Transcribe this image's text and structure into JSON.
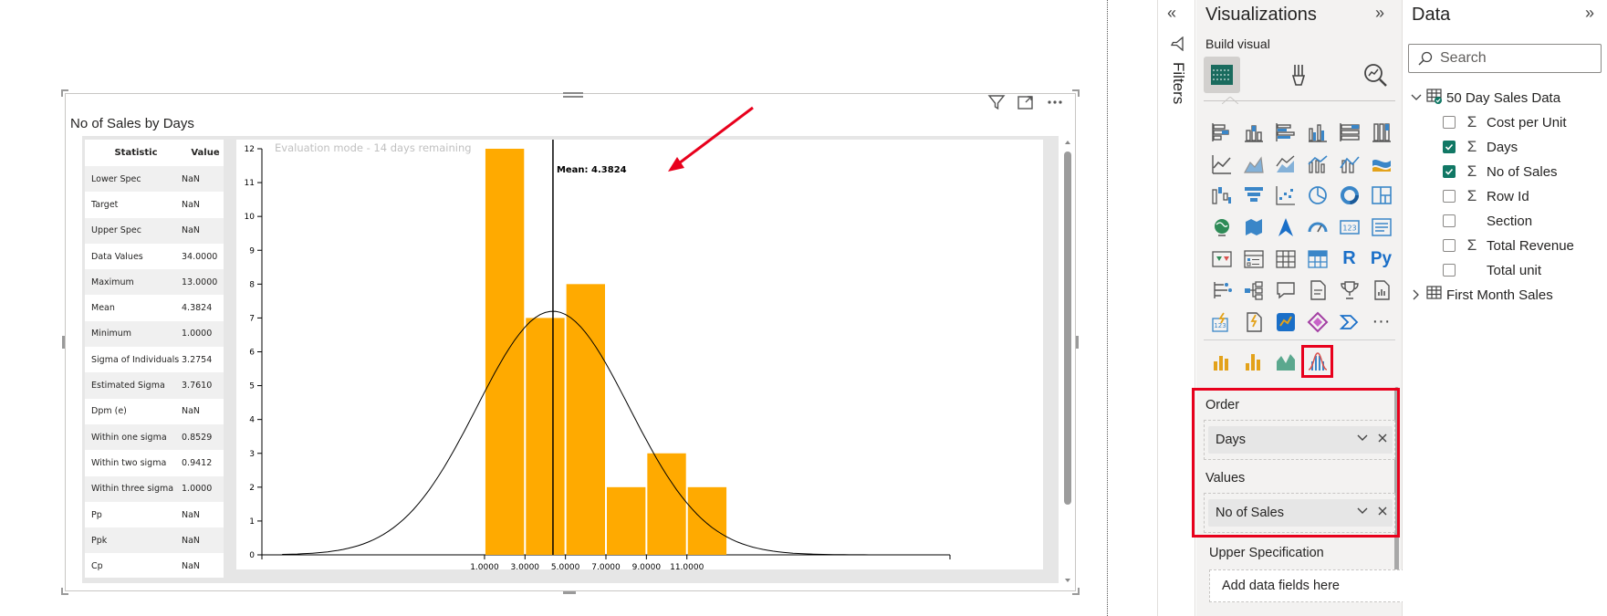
{
  "visual": {
    "title": "No of Sales by Days",
    "eval_text": "Evaluation mode - 14 days remaining",
    "stats_header": [
      "Statistic",
      "Value"
    ],
    "stats": [
      [
        "Lower Spec",
        "NaN"
      ],
      [
        "Target",
        "NaN"
      ],
      [
        "Upper Spec",
        "NaN"
      ],
      [
        "Data Values",
        "34.0000"
      ],
      [
        "Maximum",
        "13.0000"
      ],
      [
        "Mean",
        "4.3824"
      ],
      [
        "Minimum",
        "1.0000"
      ],
      [
        "Sigma of Individuals",
        "3.2754"
      ],
      [
        "Estimated Sigma",
        "3.7610"
      ],
      [
        "Dpm (e)",
        "NaN"
      ],
      [
        "Within one sigma",
        "0.8529"
      ],
      [
        "Within two sigma",
        "0.9412"
      ],
      [
        "Within three sigma",
        "1.0000"
      ],
      [
        "Pp",
        "NaN"
      ],
      [
        "Ppk",
        "NaN"
      ],
      [
        "Cp",
        "NaN"
      ]
    ]
  },
  "chart_data": {
    "type": "bar",
    "title": "",
    "bins": [
      {
        "from": 1,
        "to": 3,
        "value": 12
      },
      {
        "from": 3,
        "to": 5,
        "value": 7
      },
      {
        "from": 5,
        "to": 7,
        "value": 8
      },
      {
        "from": 7,
        "to": 9,
        "value": 2
      },
      {
        "from": 9,
        "to": 11,
        "value": 3
      },
      {
        "from": 11,
        "to": 13,
        "value": 2
      }
    ],
    "x_ticks": [
      "1.0000",
      "3.0000",
      "5.0000",
      "7.0000",
      "9.0000",
      "11.0000"
    ],
    "x_tick_values": [
      1,
      3,
      5,
      7,
      9,
      11
    ],
    "xlim": [
      -10,
      24
    ],
    "y_ticks": [
      0,
      1,
      2,
      3,
      4,
      5,
      6,
      7,
      8,
      9,
      10,
      11,
      12
    ],
    "ylim": [
      0,
      12
    ],
    "mean": 4.3824,
    "mean_label": "Mean: 4.3824",
    "sigma": 3.761,
    "curve_peak": 7.2,
    "bar_color": "#FFAA00",
    "annotation_arrow_color": "#e8001c"
  },
  "filters": {
    "label": "Filters"
  },
  "visualizations": {
    "title": "Visualizations",
    "build_label": "Build visual",
    "order_label": "Order",
    "order_field": "Days",
    "values_label": "Values",
    "values_field": "No of Sales",
    "upper_label": "Upper Specification",
    "upper_placeholder": "Add data fields here",
    "r_glyph": "R",
    "py_glyph": "Py",
    "more_glyph": "···"
  },
  "data": {
    "title": "Data",
    "search_placeholder": "Search",
    "table1": "50 Day Sales Data",
    "fields": [
      {
        "name": "Cost per Unit",
        "checked": false,
        "sigma": true
      },
      {
        "name": "Days",
        "checked": true,
        "sigma": true
      },
      {
        "name": "No of Sales",
        "checked": true,
        "sigma": true
      },
      {
        "name": "Row Id",
        "checked": false,
        "sigma": true
      },
      {
        "name": "Section",
        "checked": false,
        "sigma": false
      },
      {
        "name": "Total Revenue",
        "checked": false,
        "sigma": true
      },
      {
        "name": "Total unit",
        "checked": false,
        "sigma": false
      }
    ],
    "table2": "First Month Sales"
  }
}
